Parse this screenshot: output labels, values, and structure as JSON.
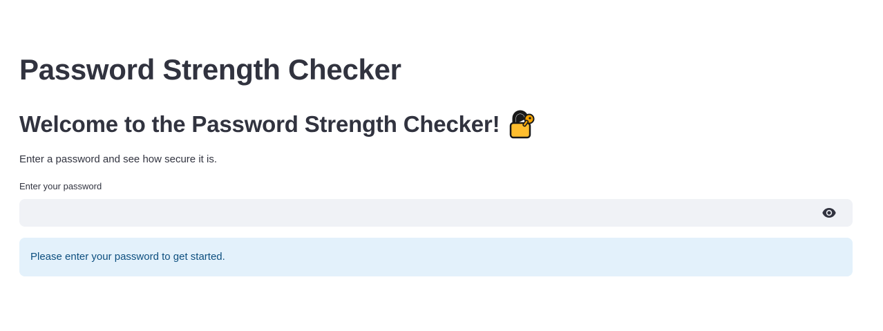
{
  "header": {
    "title": "Password Strength Checker"
  },
  "welcome": {
    "heading": "Welcome to the Password Strength Checker!",
    "emoji_icon": "locked-with-key-icon"
  },
  "intro": {
    "text": "Enter a password and see how secure it is."
  },
  "password_field": {
    "label": "Enter your password",
    "value": "",
    "placeholder": "",
    "toggle_icon": "eye-icon"
  },
  "info": {
    "message": "Please enter your password to get started."
  },
  "colors": {
    "text": "#31333f",
    "input_background": "#f0f2f6",
    "info_background": "#e3f1fb",
    "info_text": "#0d4f7f"
  }
}
